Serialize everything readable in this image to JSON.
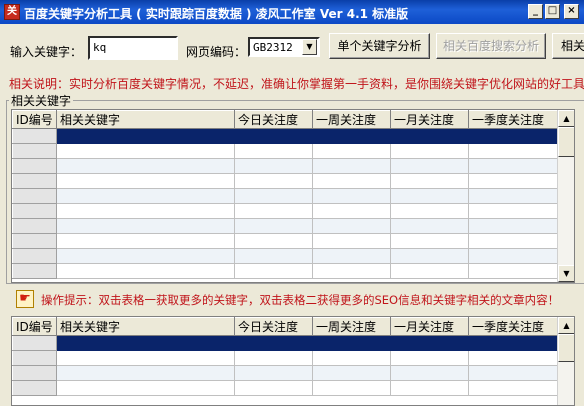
{
  "window": {
    "title": "百度关键字分析工具 ( 实时跟踪百度数据 ) 凌风工作室  Ver 4.1 标准版",
    "app_icon": "kw-app-icon",
    "minimize": "_",
    "maximize": "□",
    "close": "×"
  },
  "toolbar": {
    "keyword_label": "输入关键字：",
    "keyword_value": "kq",
    "encoding_label": "网页编码：",
    "encoding_value": "GB2312",
    "analyze_button": "单个关键字分析",
    "related_search_button": "相关百度搜索分析",
    "more_button": "相关"
  },
  "description": "相关说明：实时分析百度关键字情况，不延迟，准确让你掌握第一手资料，是你围绕关键字优化网站的好工具",
  "related_group": {
    "title": "相关关键字",
    "columns": [
      "ID编号",
      "相关关键字",
      "今日关注度",
      "一周关注度",
      "一月关注度",
      "一季度关注度"
    ],
    "row_count": 10
  },
  "tip": {
    "icon": "hand-pointer-icon",
    "text": "操作提示：双击表格一获取更多的关键字，双击表格二获得更多的SEO信息和关键字相关的文章内容！"
  },
  "lower_grid": {
    "columns": [
      "ID编号",
      "相关关键字",
      "今日关注度",
      "一周关注度",
      "一月关注度",
      "一季度关注度"
    ],
    "row_count": 4
  },
  "colors": {
    "title_bar": "#0b48c5",
    "selection": "#0a246a",
    "highlight_text": "#c0141a"
  }
}
